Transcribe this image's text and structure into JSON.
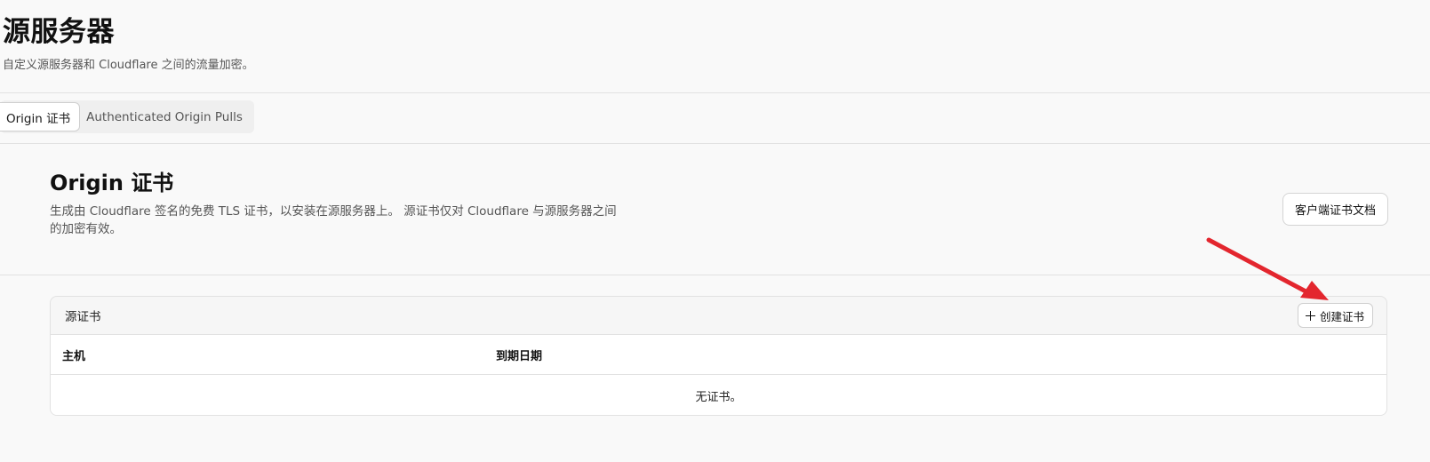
{
  "header": {
    "title": "源服务器",
    "subtitle": "自定义源服务器和 Cloudflare 之间的流量加密。"
  },
  "tabs": [
    {
      "label": "Origin 证书",
      "active": true
    },
    {
      "label": "Authenticated Origin Pulls",
      "active": false
    }
  ],
  "section": {
    "title": "Origin 证书",
    "description": "生成由 Cloudflare 签名的免费 TLS 证书，以安装在源服务器上。 源证书仅对 Cloudflare 与源服务器之间的加密有效。",
    "doc_button_label": "客户端证书文档"
  },
  "card": {
    "title": "源证书",
    "create_button_label": "创建证书",
    "create_button_icon": "plus-icon",
    "columns": [
      "主机",
      "到期日期"
    ],
    "empty_text": "无证书。"
  },
  "annotation": {
    "arrow_color": "#e3262e"
  }
}
